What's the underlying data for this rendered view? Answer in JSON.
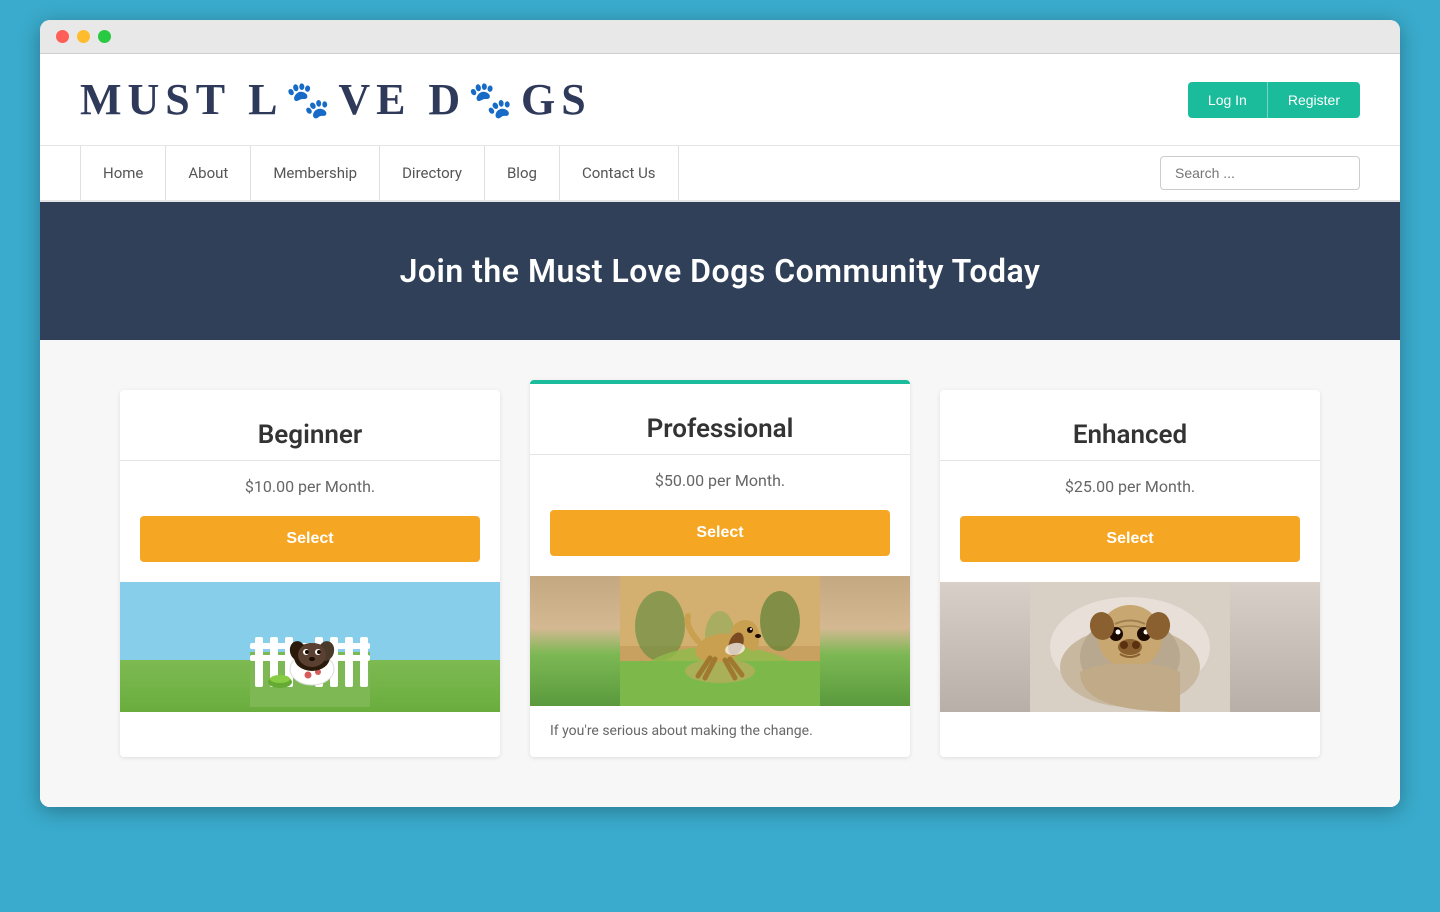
{
  "browser": {
    "traffic_lights": [
      "red",
      "yellow",
      "green"
    ]
  },
  "header": {
    "logo_text": "MUST LOVE DOGS",
    "auth": {
      "login_label": "Log In",
      "register_label": "Register"
    }
  },
  "nav": {
    "items": [
      {
        "label": "Home",
        "id": "home"
      },
      {
        "label": "About",
        "id": "about"
      },
      {
        "label": "Membership",
        "id": "membership"
      },
      {
        "label": "Directory",
        "id": "directory"
      },
      {
        "label": "Blog",
        "id": "blog"
      },
      {
        "label": "Contact Us",
        "id": "contact"
      }
    ],
    "search_placeholder": "Search ..."
  },
  "hero": {
    "title": "Join the Must Love Dogs Community Today"
  },
  "plans": [
    {
      "id": "beginner",
      "name": "Beginner",
      "price": "$10.00 per Month.",
      "select_label": "Select",
      "featured": false,
      "image_type": "puppy",
      "description": ""
    },
    {
      "id": "professional",
      "name": "Professional",
      "price": "$50.00 per Month.",
      "select_label": "Select",
      "featured": true,
      "image_type": "running-dog",
      "description": "If you're serious about making the change."
    },
    {
      "id": "enhanced",
      "name": "Enhanced",
      "price": "$25.00 per Month.",
      "select_label": "Select",
      "featured": false,
      "image_type": "pug",
      "description": ""
    }
  ]
}
